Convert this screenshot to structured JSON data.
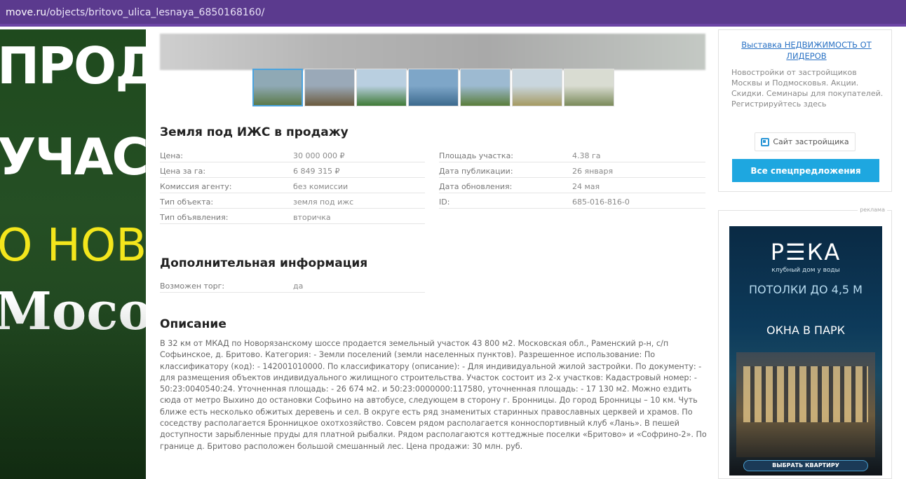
{
  "browser": {
    "url_host": "move.ru",
    "url_path": "/objects/britovo_ulica_lesnaya_6850168160/"
  },
  "left_banner": {
    "line1": "ПРОД",
    "line2": "УЧАС",
    "line3": "О НОВ",
    "line4": "Мособ"
  },
  "listing": {
    "title": "Земля под ИЖС в продажу",
    "props_left": [
      {
        "key": "Цена:",
        "value": "30 000 000 ₽"
      },
      {
        "key": "Цена за га:",
        "value": "6 849 315 ₽"
      },
      {
        "key": "Комиссия агенту:",
        "value": "без комиссии"
      },
      {
        "key": "Тип объекта:",
        "value": "земля под ижс"
      },
      {
        "key": "Тип объявления:",
        "value": "вторичка"
      }
    ],
    "props_right": [
      {
        "key": "Площадь участка:",
        "value": "4.38 га"
      },
      {
        "key": "Дата публикации:",
        "value": "26 января"
      },
      {
        "key": "Дата обновления:",
        "value": "24 мая"
      },
      {
        "key": "ID:",
        "value": "685-016-816-0"
      }
    ],
    "additional_title": "Дополнительная информация",
    "additional": [
      {
        "key": "Возможен торг:",
        "value": "да"
      }
    ],
    "description_title": "Описание",
    "description": "В 32 км от МКАД по Новорязанскому шоссе продается земельный участок 43 800 м2. Московская обл., Раменский р-н, с/п Софьинское, д. Бритово. Категория: - Земли поселений (земли населенных пунктов). Разрешенное использование: По классификатору (код): - 142001010000. По классификатору (описание): - Для индивидуальной жилой застройки. По документу: - для размещения объектов индивидуального жилищного строительства. Участок состоит из 2-х участков: Кадастровый номер: - 50:23:0040540:24. Уточненная площадь: - 26 674 м2. и 50:23:0000000:117580, уточненная площадь: - 17 130 м2. Можно ездить сюда от метро Выхино до остановки Софьино на автобусе, следующем в сторону г. Бронницы. До город Бронницы – 10 км. Чуть ближе есть несколько обжитых деревень и сел. В округе есть ряд знаменитых старинных православных церквей и храмов. По соседству располагается Бронницкое охотхозяйство. Совсем рядом располагается конноспортивный клуб «Лань». В пешей доступности зарыбленные пруды для платной рыбалки. Рядом располагаются коттеджные поселки «Бритово» и «Софрино-2». По границе д. Бритово расположен большой смешанный лес. Цена продажи: 30 млн. руб."
  },
  "thumbnails": [
    {
      "name": "photo-1",
      "colors": [
        "#8fa9b5",
        "#5b7a4a"
      ]
    },
    {
      "name": "photo-2",
      "colors": [
        "#9aa9b8",
        "#6b5a3e"
      ]
    },
    {
      "name": "photo-3",
      "colors": [
        "#b9cfe0",
        "#3f7a36"
      ]
    },
    {
      "name": "photo-4",
      "colors": [
        "#7ea6c8",
        "#3c6a8e"
      ]
    },
    {
      "name": "photo-5",
      "colors": [
        "#9dbad1",
        "#5a7d3a"
      ]
    },
    {
      "name": "photo-6",
      "colors": [
        "#c9d6de",
        "#a59a62"
      ]
    },
    {
      "name": "map",
      "colors": [
        "#d9dcd2",
        "#7a8a5a"
      ]
    }
  ],
  "sidebar": {
    "promo_link": "Выставка НЕДВИЖИМОСТЬ ОТ ЛИДЕРОВ",
    "promo_text": "Новостройки от застройщиков Москвы и Подмосковья. Акции. Скидки. Семинары для покупателей. Регистрируйтесь здесь",
    "site_button": "Сайт застройщика",
    "all_offers_button": "Все спецпредложения",
    "ad_label": "реклама",
    "ad": {
      "logo": "Р☰КА",
      "subtitle": "клубный дом у воды",
      "headline": "ПОТОЛКИ ДО 4,5 М",
      "headline2": "ОКНА В ПАРК",
      "cta": "ВЫБРАТЬ КВАРТИРУ"
    }
  },
  "colors": {
    "urlbar": "#5b3a8e",
    "accent_blue": "#1ea7e0",
    "link_blue": "#2a72c4",
    "banner_green": "#1f4a1e",
    "banner_yellow": "#f3e61c"
  }
}
